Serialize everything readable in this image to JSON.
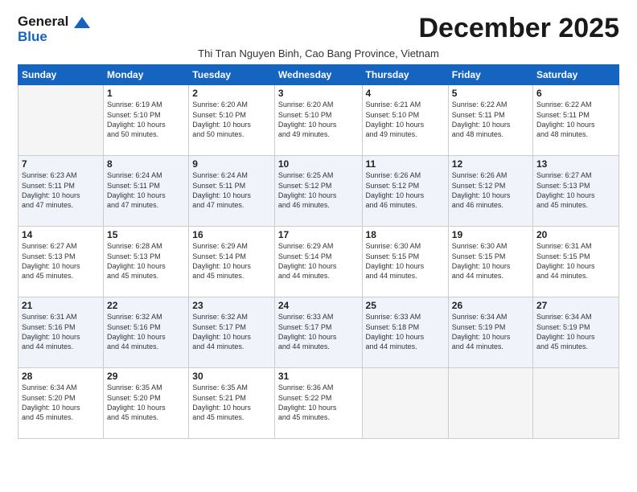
{
  "logo": {
    "general": "General",
    "blue": "Blue"
  },
  "title": "December 2025",
  "subtitle": "Thi Tran Nguyen Binh, Cao Bang Province, Vietnam",
  "days_of_week": [
    "Sunday",
    "Monday",
    "Tuesday",
    "Wednesday",
    "Thursday",
    "Friday",
    "Saturday"
  ],
  "weeks": [
    [
      {
        "day": "",
        "info": ""
      },
      {
        "day": "1",
        "info": "Sunrise: 6:19 AM\nSunset: 5:10 PM\nDaylight: 10 hours\nand 50 minutes."
      },
      {
        "day": "2",
        "info": "Sunrise: 6:20 AM\nSunset: 5:10 PM\nDaylight: 10 hours\nand 50 minutes."
      },
      {
        "day": "3",
        "info": "Sunrise: 6:20 AM\nSunset: 5:10 PM\nDaylight: 10 hours\nand 49 minutes."
      },
      {
        "day": "4",
        "info": "Sunrise: 6:21 AM\nSunset: 5:10 PM\nDaylight: 10 hours\nand 49 minutes."
      },
      {
        "day": "5",
        "info": "Sunrise: 6:22 AM\nSunset: 5:11 PM\nDaylight: 10 hours\nand 48 minutes."
      },
      {
        "day": "6",
        "info": "Sunrise: 6:22 AM\nSunset: 5:11 PM\nDaylight: 10 hours\nand 48 minutes."
      }
    ],
    [
      {
        "day": "7",
        "info": "Sunrise: 6:23 AM\nSunset: 5:11 PM\nDaylight: 10 hours\nand 47 minutes."
      },
      {
        "day": "8",
        "info": "Sunrise: 6:24 AM\nSunset: 5:11 PM\nDaylight: 10 hours\nand 47 minutes."
      },
      {
        "day": "9",
        "info": "Sunrise: 6:24 AM\nSunset: 5:11 PM\nDaylight: 10 hours\nand 47 minutes."
      },
      {
        "day": "10",
        "info": "Sunrise: 6:25 AM\nSunset: 5:12 PM\nDaylight: 10 hours\nand 46 minutes."
      },
      {
        "day": "11",
        "info": "Sunrise: 6:26 AM\nSunset: 5:12 PM\nDaylight: 10 hours\nand 46 minutes."
      },
      {
        "day": "12",
        "info": "Sunrise: 6:26 AM\nSunset: 5:12 PM\nDaylight: 10 hours\nand 46 minutes."
      },
      {
        "day": "13",
        "info": "Sunrise: 6:27 AM\nSunset: 5:13 PM\nDaylight: 10 hours\nand 45 minutes."
      }
    ],
    [
      {
        "day": "14",
        "info": "Sunrise: 6:27 AM\nSunset: 5:13 PM\nDaylight: 10 hours\nand 45 minutes."
      },
      {
        "day": "15",
        "info": "Sunrise: 6:28 AM\nSunset: 5:13 PM\nDaylight: 10 hours\nand 45 minutes."
      },
      {
        "day": "16",
        "info": "Sunrise: 6:29 AM\nSunset: 5:14 PM\nDaylight: 10 hours\nand 45 minutes."
      },
      {
        "day": "17",
        "info": "Sunrise: 6:29 AM\nSunset: 5:14 PM\nDaylight: 10 hours\nand 44 minutes."
      },
      {
        "day": "18",
        "info": "Sunrise: 6:30 AM\nSunset: 5:15 PM\nDaylight: 10 hours\nand 44 minutes."
      },
      {
        "day": "19",
        "info": "Sunrise: 6:30 AM\nSunset: 5:15 PM\nDaylight: 10 hours\nand 44 minutes."
      },
      {
        "day": "20",
        "info": "Sunrise: 6:31 AM\nSunset: 5:15 PM\nDaylight: 10 hours\nand 44 minutes."
      }
    ],
    [
      {
        "day": "21",
        "info": "Sunrise: 6:31 AM\nSunset: 5:16 PM\nDaylight: 10 hours\nand 44 minutes."
      },
      {
        "day": "22",
        "info": "Sunrise: 6:32 AM\nSunset: 5:16 PM\nDaylight: 10 hours\nand 44 minutes."
      },
      {
        "day": "23",
        "info": "Sunrise: 6:32 AM\nSunset: 5:17 PM\nDaylight: 10 hours\nand 44 minutes."
      },
      {
        "day": "24",
        "info": "Sunrise: 6:33 AM\nSunset: 5:17 PM\nDaylight: 10 hours\nand 44 minutes."
      },
      {
        "day": "25",
        "info": "Sunrise: 6:33 AM\nSunset: 5:18 PM\nDaylight: 10 hours\nand 44 minutes."
      },
      {
        "day": "26",
        "info": "Sunrise: 6:34 AM\nSunset: 5:19 PM\nDaylight: 10 hours\nand 44 minutes."
      },
      {
        "day": "27",
        "info": "Sunrise: 6:34 AM\nSunset: 5:19 PM\nDaylight: 10 hours\nand 45 minutes."
      }
    ],
    [
      {
        "day": "28",
        "info": "Sunrise: 6:34 AM\nSunset: 5:20 PM\nDaylight: 10 hours\nand 45 minutes."
      },
      {
        "day": "29",
        "info": "Sunrise: 6:35 AM\nSunset: 5:20 PM\nDaylight: 10 hours\nand 45 minutes."
      },
      {
        "day": "30",
        "info": "Sunrise: 6:35 AM\nSunset: 5:21 PM\nDaylight: 10 hours\nand 45 minutes."
      },
      {
        "day": "31",
        "info": "Sunrise: 6:36 AM\nSunset: 5:22 PM\nDaylight: 10 hours\nand 45 minutes."
      },
      {
        "day": "",
        "info": ""
      },
      {
        "day": "",
        "info": ""
      },
      {
        "day": "",
        "info": ""
      }
    ]
  ]
}
